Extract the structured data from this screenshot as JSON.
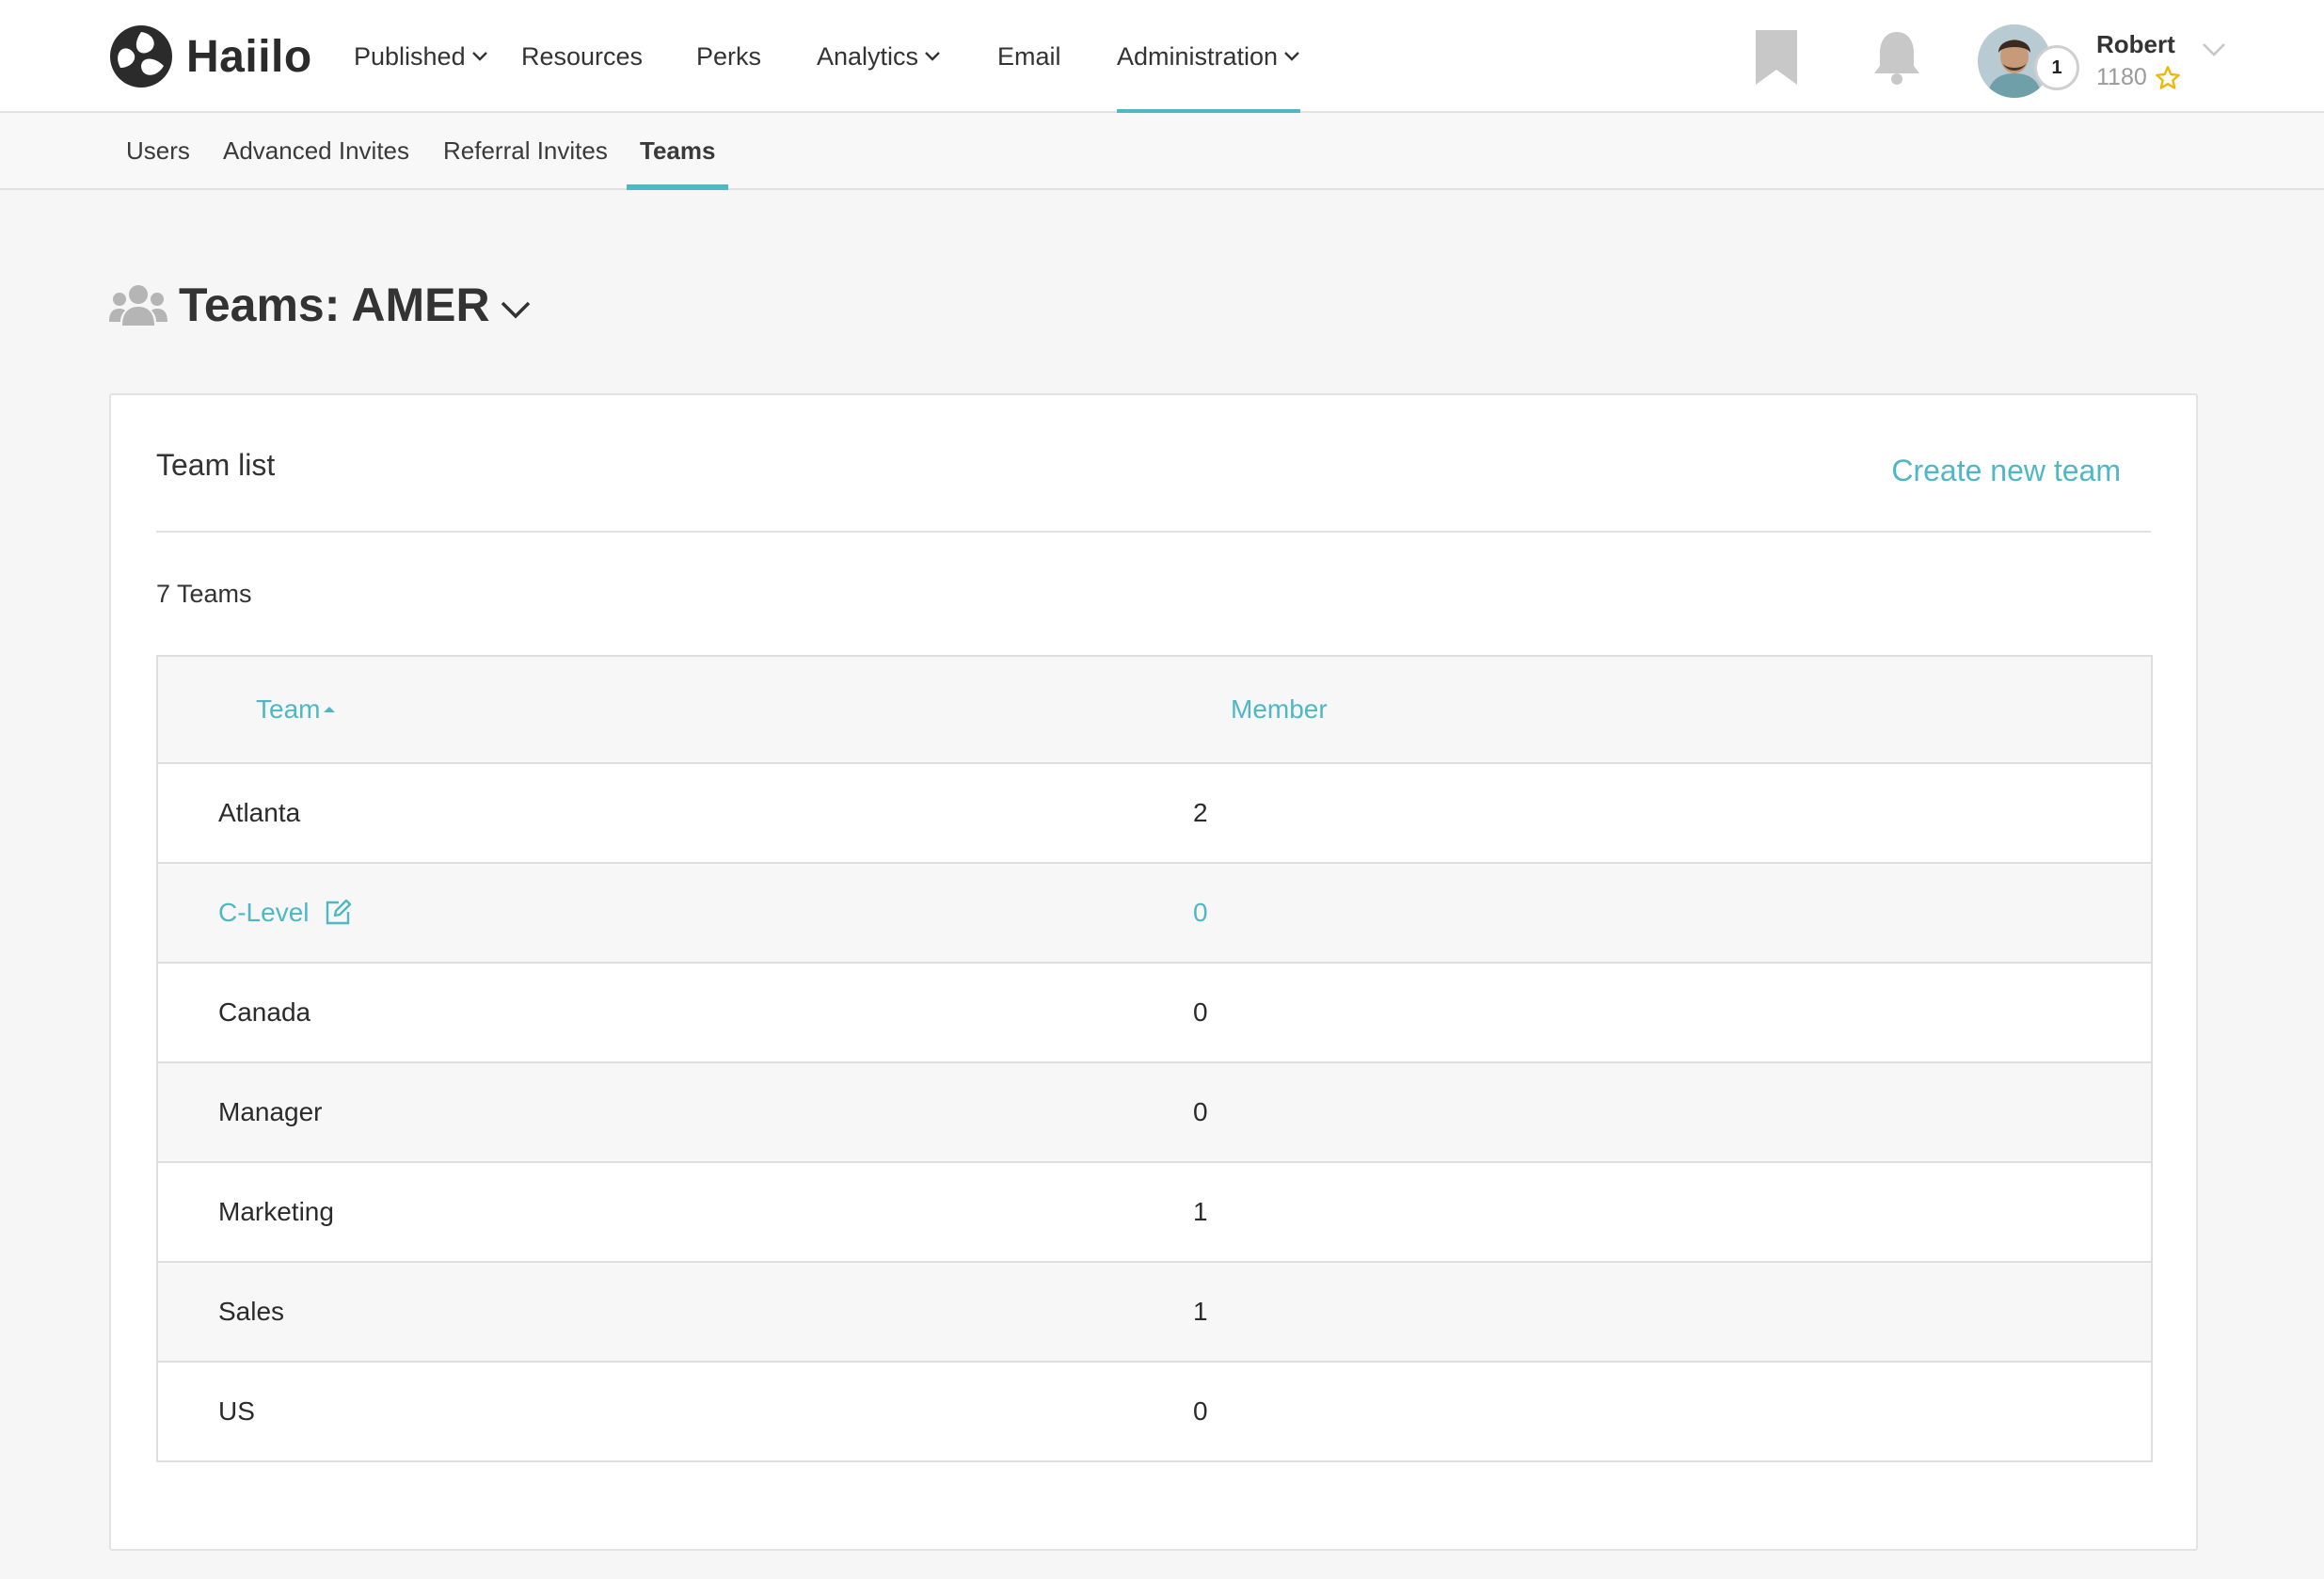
{
  "app": {
    "logo_text": "Haiilo"
  },
  "nav": {
    "items": [
      {
        "label": "Published",
        "has_dropdown": true,
        "active": false
      },
      {
        "label": "Resources",
        "has_dropdown": false,
        "active": false
      },
      {
        "label": "Perks",
        "has_dropdown": false,
        "active": false
      },
      {
        "label": "Analytics",
        "has_dropdown": true,
        "active": false
      },
      {
        "label": "Email",
        "has_dropdown": false,
        "active": false
      },
      {
        "label": "Administration",
        "has_dropdown": true,
        "active": true
      }
    ],
    "icons": [
      "bookmark-icon",
      "bell-icon"
    ]
  },
  "user": {
    "name": "Robert",
    "points": "1180",
    "level": "1"
  },
  "subnav": {
    "items": [
      {
        "label": "Users",
        "active": false
      },
      {
        "label": "Advanced Invites",
        "active": false
      },
      {
        "label": "Referral Invites",
        "active": false
      },
      {
        "label": "Teams",
        "active": true
      }
    ]
  },
  "page": {
    "title": "Teams: AMER"
  },
  "card": {
    "title": "Team list",
    "create_label": "Create new team",
    "count_label": "7 Teams"
  },
  "table": {
    "headers": {
      "team": "Team",
      "member": "Member"
    },
    "sort": {
      "column": "team",
      "direction": "ascending"
    },
    "rows": [
      {
        "team": "Atlanta",
        "member": "2"
      },
      {
        "team": "C-Level",
        "member": "0"
      },
      {
        "team": "Canada",
        "member": "0"
      },
      {
        "team": "Manager",
        "member": "0"
      },
      {
        "team": "Marketing",
        "member": "1"
      },
      {
        "team": "Sales",
        "member": "1"
      },
      {
        "team": "US",
        "member": "0"
      }
    ]
  },
  "colors": {
    "accent": "#4fb8c4",
    "star": "#f2b600",
    "text": "#333333",
    "muted": "#9a9a9a",
    "icon_gray": "#c8c8c8"
  }
}
